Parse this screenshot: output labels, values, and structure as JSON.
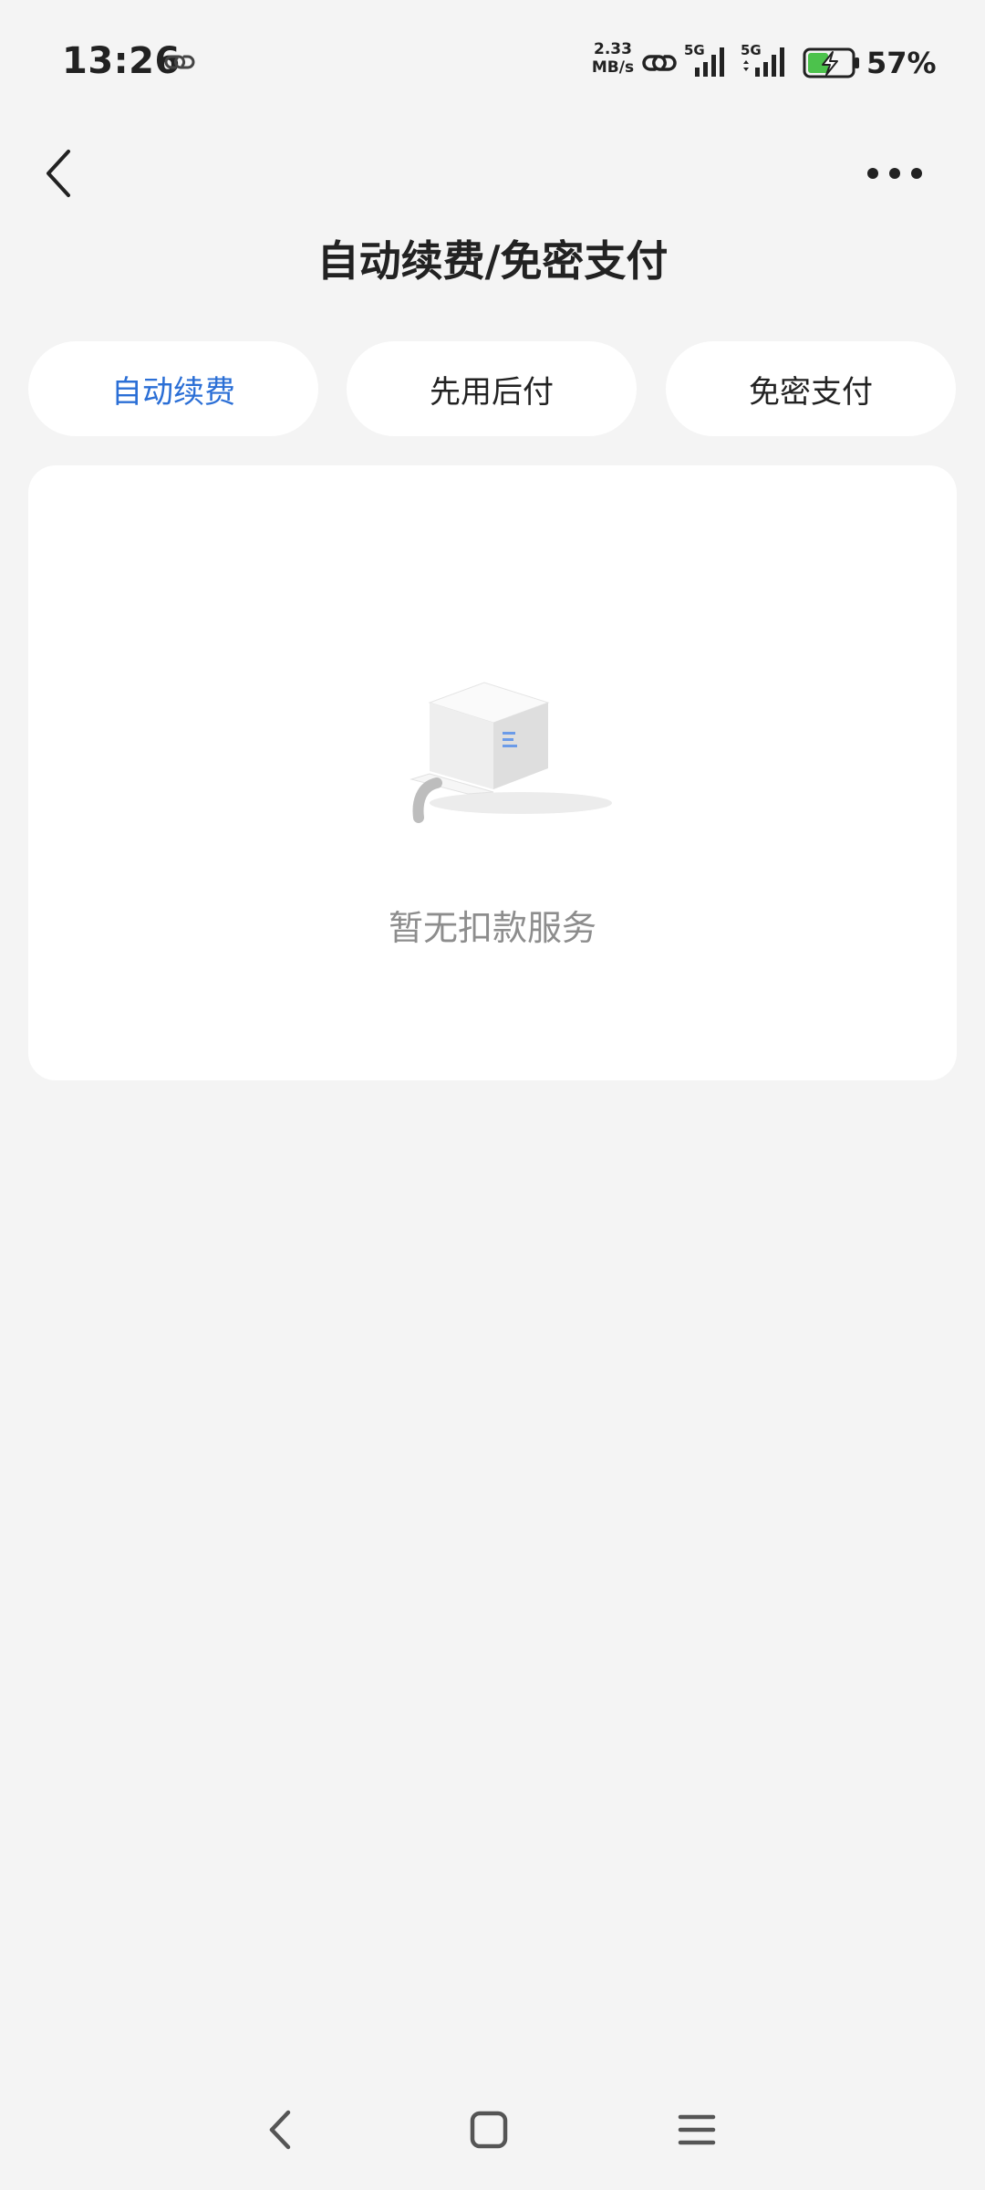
{
  "status_bar": {
    "time": "13:26",
    "net_speed_value": "2.33",
    "net_speed_unit": "MB/s",
    "signal1_label": "5G",
    "signal2_label": "5G",
    "battery_percent": "57%"
  },
  "header": {
    "title": "自动续费/免密支付",
    "back_icon": "chevron-left-icon",
    "more_icon": "more-dots-icon"
  },
  "tabs": [
    {
      "label": "自动续费",
      "active": true
    },
    {
      "label": "先用后付",
      "active": false
    },
    {
      "label": "免密支付",
      "active": false
    }
  ],
  "empty_state": {
    "text": "暂无扣款服务",
    "icon": "empty-box-illustration"
  },
  "colors": {
    "accent": "#2b6fd6",
    "background": "#f4f4f4",
    "card": "#ffffff",
    "muted_text": "#8d8d8d"
  }
}
